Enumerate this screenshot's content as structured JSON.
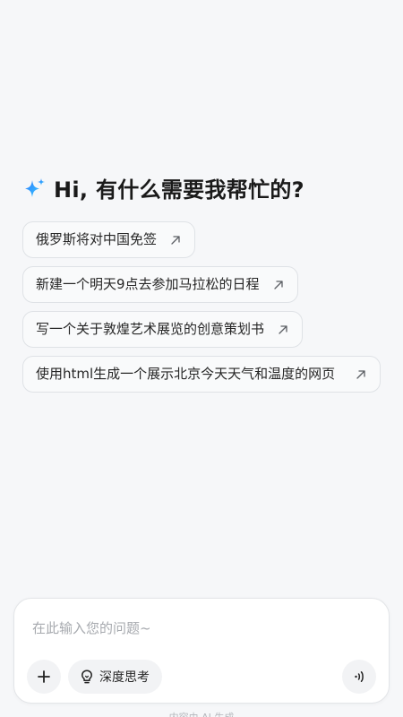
{
  "greeting": {
    "icon": "sparkle-icon",
    "text": "Hi, 有什么需要我帮忙的?"
  },
  "suggestions": [
    {
      "label": "俄罗斯将对中国免签",
      "icon": "arrow-up-right-icon"
    },
    {
      "label": "新建一个明天9点去参加马拉松的日程",
      "icon": "arrow-up-right-icon"
    },
    {
      "label": "写一个关于敦煌艺术展览的创意策划书",
      "icon": "arrow-up-right-icon"
    },
    {
      "label": "使用html生成一个展示北京今天天气和温度的网页",
      "icon": "arrow-up-right-icon"
    }
  ],
  "composer": {
    "placeholder": "在此输入您的问题~",
    "plus_icon": "plus-icon",
    "deep_think_icon": "lightbulb-icon",
    "deep_think_label": "深度思考",
    "voice_icon": "sound-wave-icon"
  },
  "footer": {
    "note": "内容由 AI 生成"
  },
  "colors": {
    "background": "#f6f7f9",
    "sparkle_start": "#2f7bff",
    "sparkle_end": "#35c6ff",
    "chip_border": "#dfe2e6"
  }
}
